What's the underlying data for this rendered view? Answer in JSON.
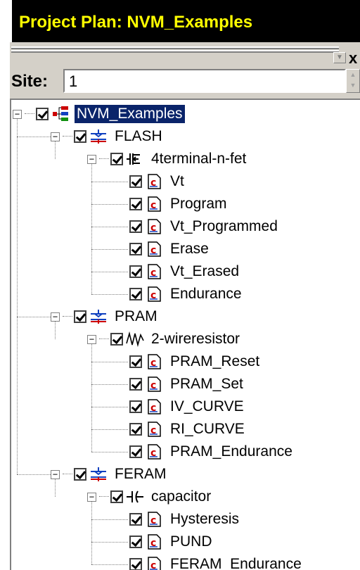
{
  "window": {
    "title": "Project Plan: NVM_Examples"
  },
  "toolbar": {
    "close_label": "x"
  },
  "site": {
    "label": "Site:",
    "value": "1"
  },
  "tree": {
    "root": {
      "label": "NVM_Examples",
      "icon": "project-tree-icon",
      "selected": true
    },
    "groups": [
      {
        "label": "FLASH",
        "icon": "technology-icon",
        "device": {
          "label": "4terminal-n-fet",
          "icon": "transistor-icon"
        },
        "tests": [
          "Vt",
          "Program",
          "Vt_Programmed",
          "Erase",
          "Vt_Erased",
          "Endurance"
        ]
      },
      {
        "label": "PRAM",
        "icon": "technology-icon",
        "device": {
          "label": "2-wireresistor",
          "icon": "resistor-icon"
        },
        "tests": [
          "PRAM_Reset",
          "PRAM_Set",
          "IV_CURVE",
          "RI_CURVE",
          "PRAM_Endurance"
        ]
      },
      {
        "label": "FERAM",
        "icon": "technology-icon",
        "device": {
          "label": "capacitor",
          "icon": "capacitor-icon"
        },
        "tests": [
          "Hysteresis",
          "PUND",
          "FERAM_Endurance"
        ]
      }
    ]
  },
  "colors": {
    "selection": "#0a246a",
    "title_text": "#ffff00",
    "test_icon": "#cc0000"
  }
}
